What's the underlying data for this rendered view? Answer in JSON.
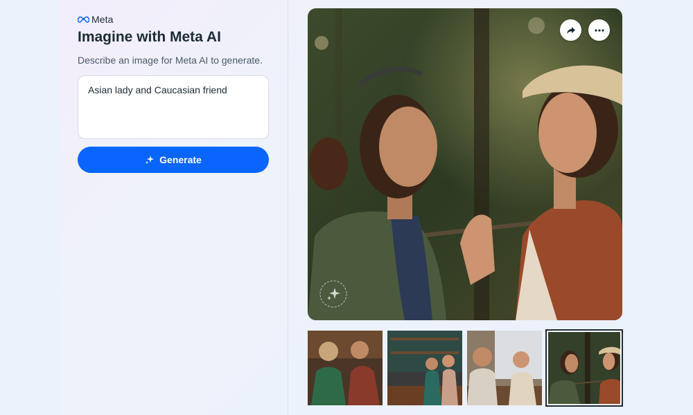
{
  "brand": {
    "name": "Meta",
    "logo_icon": "meta-infinity-icon"
  },
  "header": {
    "title": "Imagine with Meta AI",
    "subtitle": "Describe an image for Meta AI to generate."
  },
  "prompt": {
    "value": "Asian lady and Caucasian friend"
  },
  "generate_button": {
    "label": "Generate",
    "icon": "sparkle-icon"
  },
  "image_actions": {
    "share_icon": "share-arrow-icon",
    "more_icon": "more-dots-icon"
  },
  "thumbnails": {
    "count": 4,
    "selected_index": 3
  },
  "colors": {
    "accent": "#0866ff",
    "text": "#1c2b33",
    "background": "#ecf2fb"
  }
}
